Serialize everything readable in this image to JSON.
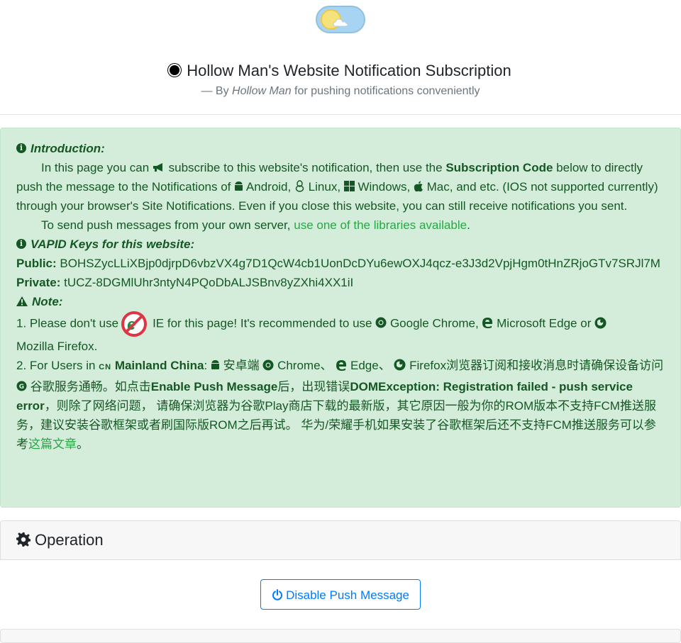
{
  "header": {
    "title": "Hollow Man's Website Notification Subscription",
    "subtitle_prefix": "— By ",
    "subtitle_author": "Hollow Man",
    "subtitle_suffix": " for pushing notifications conveniently"
  },
  "intro": {
    "heading": "Introduction:",
    "p1_a": "In this page you can ",
    "p1_b": " subscribe to this website's notification, then use the ",
    "p1_bold": "Subscription Code",
    "p1_c": " below to directly push the message to the Notifications of ",
    "android": " Android, ",
    "linux": " Linux, ",
    "windows": " Windows, ",
    "mac": " Mac, and etc. (IOS not supported currently) through your browser's Site Notifications. Even if you close this website, you can still receive notifications you sent.",
    "p2_a": "To send push messages from your own server, ",
    "p2_link": "use one of the libraries available",
    "p2_end": "."
  },
  "vapid": {
    "heading": "VAPID Keys for this website:",
    "public_label": "Public:",
    "public_value": " BOHSZycLLiXBjp0djrpD6vbzVX4g7D1QcW4cb1UonDcDYu6ewOXJ4qcz-e3J3d2VpjHgm0tHnZRjoGTv7SRJl7M",
    "private_label": "Private:",
    "private_value": " tUCZ-8DGMlUhr3ntyN4PQoDbALJSBnv8yZXhi4XX1iI"
  },
  "note": {
    "heading": "Note:",
    "n1_a": "1. Please don't use",
    "n1_b": "IE for this page! It's recommended to use ",
    "n1_chrome": " Google Chrome, ",
    "n1_edge": " Microsoft Edge or ",
    "n1_firefox": "Mozilla Firefox.",
    "n2_a": "2. For Users in ",
    "n2_cn": "CN",
    "n2_bold1": " Mainland China",
    "n2_b": ": ",
    "n2_android": " 安卓端 ",
    "n2_chrome": " Chrome、 ",
    "n2_edge": " Edge、 ",
    "n2_firefox": " Firefox浏览器订阅和接收消息时请确保设备访问 ",
    "n2_google": " 谷歌服务通畅。如点击",
    "n2_bold2": "Enable Push Message",
    "n2_c": "后，出现错误",
    "n2_bold3": "DOMException: Registration failed - push service error",
    "n2_d": "，则除了网络问题， 请确保浏览器为谷歌Play商店下载的最新版，其它原因一般为你的ROM版本不支持FCM推送服务，建议安装谷歌框架或者刷国际版ROM之后再试。 华为/荣耀手机如果安装了谷歌框架后还不支持FCM推送服务可以参考",
    "n2_link": "这篇文章",
    "n2_end": "。"
  },
  "operation": {
    "heading": "Operation",
    "button_label": "Disable Push Message"
  },
  "colors": {
    "alert_bg": "#d4edda",
    "alert_text": "#155724",
    "link": "#28a745",
    "primary": "#007bff"
  }
}
